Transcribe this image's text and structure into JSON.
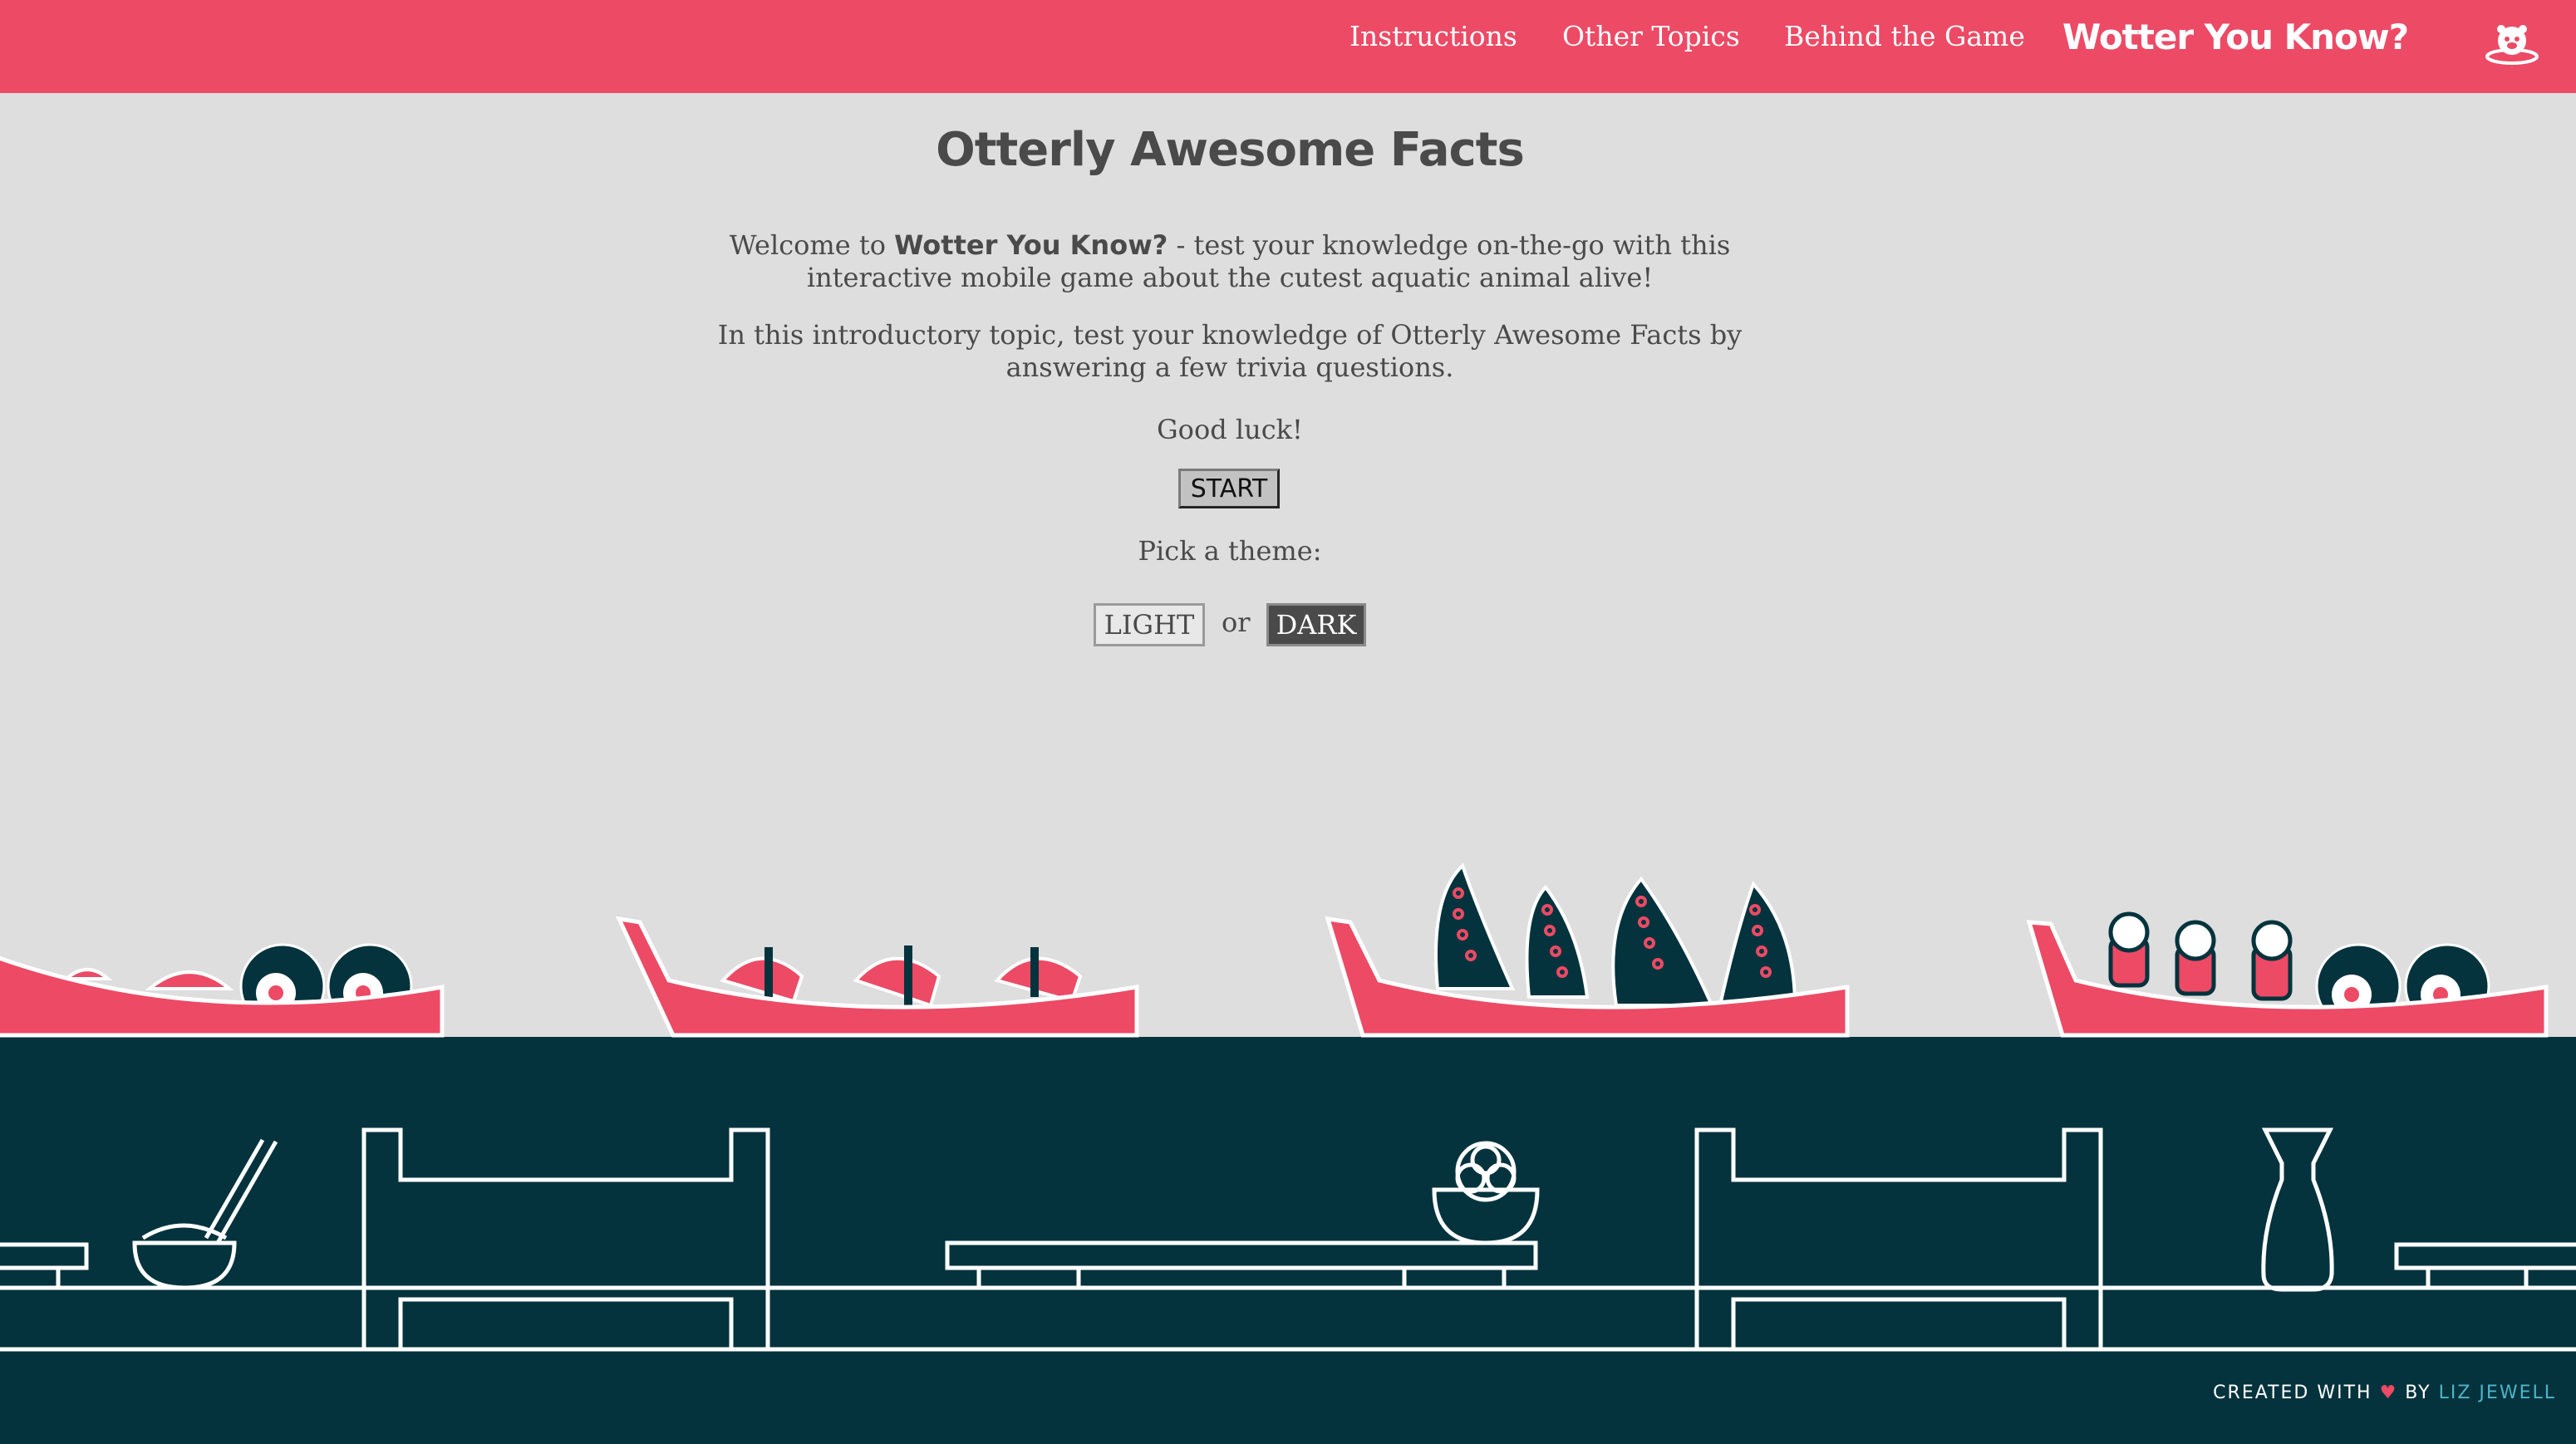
{
  "nav": {
    "links": [
      "Instructions",
      "Other Topics",
      "Behind the Game"
    ],
    "brand": "Wotter You Know?",
    "icon": "otter-icon"
  },
  "main": {
    "title": "Otterly Awesome Facts",
    "welcome_prefix": "Welcome to ",
    "welcome_bold": "Wotter You Know?",
    "welcome_suffix": " - test your knowledge on-the-go with this interactive mobile game about the cutest aquatic animal alive!",
    "intro": "In this introductory topic, test your knowledge of Otterly Awesome Facts by answering a few trivia questions.",
    "good_luck": "Good luck!",
    "start_label": "START",
    "theme_prompt": "Pick a theme:",
    "light_label": "LIGHT",
    "or_text": "or",
    "dark_label": "DARK"
  },
  "footer": {
    "created_with": "CREATED WITH",
    "heart": "♥",
    "by": "BY",
    "author": "LIZ JEWELL"
  },
  "colors": {
    "accent": "#ec4a65",
    "dark_teal": "#04333d",
    "background": "#dedede",
    "text": "#4a4a4a",
    "link": "#4fb3c8"
  }
}
